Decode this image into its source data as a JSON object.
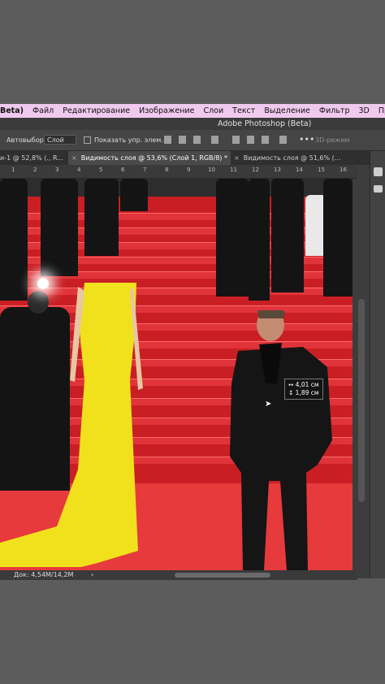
{
  "menu": [
    "Beta)",
    "Файл",
    "Редактирование",
    "Изображение",
    "Слои",
    "Текст",
    "Выделение",
    "Фильтр",
    "3D",
    "Пр"
  ],
  "window_title": "Adobe Photoshop (Beta)",
  "options": {
    "autoselect_label": "Автовыбор:",
    "autoselect_value": "Слой",
    "show_controls_label": "Показать упр. элем.",
    "more": "•••",
    "mode_3d": "3D-режим"
  },
  "tabs": [
    {
      "label": "и-1 @ 52,8% (., R...",
      "close": "×"
    },
    {
      "label": "Видимость слоя @ 53,6% (Слой 1, RGB/8) *",
      "close": "×"
    },
    {
      "label": "Видимость слоя @ 51,6% (...",
      "close": ""
    }
  ],
  "ruler_numbers": [
    "1",
    "2",
    "3",
    "4",
    "5",
    "6",
    "7",
    "8",
    "9",
    "10",
    "11",
    "12",
    "13",
    "14",
    "15",
    "16"
  ],
  "measure": {
    "width": "↔ 4,01 см",
    "height": "↕ 1,89 см"
  },
  "status": {
    "doc": "Док: 4,54M/14,2M",
    "arrow": "›"
  }
}
